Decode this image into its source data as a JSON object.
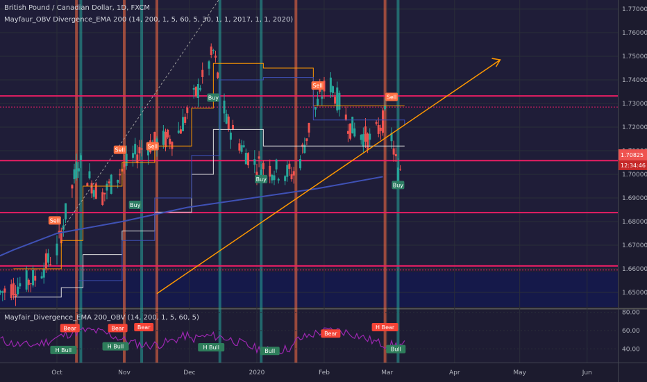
{
  "header": {
    "symbol_line": "British Pound / Canadian Dollar, 1D, FXCM",
    "indicator_line": "Mayfaur_OBV Divergence_EMA 200 (14, 200, 1, 5, 60, 5, 30, 1, 1, 2017, 1, 1, 2020)"
  },
  "oscillator": {
    "legend": "Mayfair_Divergence_EMA 200_OBV (14, 200, 1, 5, 60, 5)",
    "ticks": [
      "80.00",
      "60.00",
      "40.00"
    ],
    "tick_values": [
      80,
      60,
      40
    ],
    "range": [
      25,
      82
    ]
  },
  "price_axis": {
    "ticks": [
      "1.77000",
      "1.76000",
      "1.75000",
      "1.74000",
      "1.73000",
      "1.72000",
      "1.71000",
      "1.70000",
      "1.69000",
      "1.68000",
      "1.67000",
      "1.66000",
      "1.65000"
    ],
    "tick_values": [
      1.77,
      1.76,
      1.75,
      1.74,
      1.73,
      1.72,
      1.71,
      1.7,
      1.69,
      1.68,
      1.67,
      1.66,
      1.65
    ],
    "last_price": "1.70825",
    "last_value": 1.70825,
    "countdown": "12:34:46",
    "range": [
      1.645,
      1.775
    ]
  },
  "time_axis": {
    "labels": [
      "Oct",
      "Nov",
      "Dec",
      "2020",
      "Feb",
      "Mar",
      "Apr",
      "May",
      "Jun"
    ],
    "label_days": [
      0,
      31,
      61,
      92,
      123,
      152,
      183,
      213,
      244
    ]
  },
  "colors": {
    "background": "#1c1b2e",
    "candle_up": "#26a69a",
    "candle_down": "#ef5350",
    "resistance": "#e91e63",
    "ema": "#3f51b5",
    "trendline": "#ff9800",
    "oscillator_line": "#9c27b0",
    "buy_badge": "#4caf50",
    "sell_badge": "#ff7043",
    "bear_badge": "#f44336",
    "bull_badge": "#43a047"
  },
  "chart_data": {
    "type": "candlestick",
    "title": "British Pound / Canadian Dollar, 1D, FXCM",
    "ylim": [
      1.645,
      1.775
    ],
    "grid": true,
    "horizontal_levels": [
      1.7332,
      1.7285,
      1.7058,
      1.6838,
      1.6612,
      1.6595
    ],
    "ema200": [
      {
        "day": -45,
        "value": 1.658
      },
      {
        "day": -20,
        "value": 1.668
      },
      {
        "day": 0,
        "value": 1.675
      },
      {
        "day": 30,
        "value": 1.68
      },
      {
        "day": 60,
        "value": 1.686
      },
      {
        "day": 90,
        "value": 1.69
      },
      {
        "day": 120,
        "value": 1.694
      },
      {
        "day": 150,
        "value": 1.699
      }
    ],
    "trendlines": [
      {
        "from": {
          "day": 46,
          "value": 1.6495
        },
        "to": {
          "day": 204,
          "value": 1.7485
        }
      }
    ],
    "signals": [
      {
        "label": "Sell",
        "day": -1,
        "value": 1.6802
      },
      {
        "label": "Sell",
        "day": 29,
        "value": 1.7101
      },
      {
        "label": "Sell",
        "day": 44,
        "value": 1.7116
      },
      {
        "label": "Buy",
        "day": 72,
        "value": 1.7322
      },
      {
        "label": "Sell",
        "day": 120,
        "value": 1.7373
      },
      {
        "label": "Buy",
        "day": 94,
        "value": 1.6977
      },
      {
        "label": "Buy",
        "day": 36,
        "value": 1.6868
      },
      {
        "label": "Sell",
        "day": 154,
        "value": 1.7325
      },
      {
        "label": "Buy",
        "day": 157,
        "value": 1.6952
      }
    ],
    "oscillator_signals": [
      {
        "label": "Bear",
        "day": 6,
        "value": 62
      },
      {
        "label": "Bear",
        "day": 28,
        "value": 62
      },
      {
        "label": "Bear",
        "day": 40,
        "value": 63
      },
      {
        "label": "Bear",
        "day": 126,
        "value": 56
      },
      {
        "label": "H Bear",
        "day": 151,
        "value": 63
      },
      {
        "label": "H Bull",
        "day": 3,
        "value": 38
      },
      {
        "label": "H Bull",
        "day": 27,
        "value": 42
      },
      {
        "label": "H Bull",
        "day": 71,
        "value": 41
      },
      {
        "label": "Bull",
        "day": 98,
        "value": 37
      },
      {
        "label": "Bull",
        "day": 156,
        "value": 39
      }
    ]
  }
}
